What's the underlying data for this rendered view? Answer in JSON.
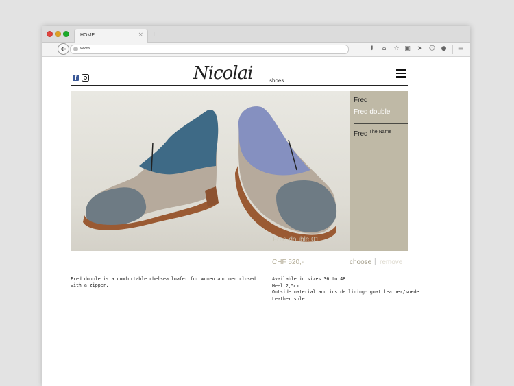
{
  "browser": {
    "tab_title": "HOME",
    "tab_close": "×",
    "new_tab": "+",
    "url": "www"
  },
  "header": {
    "logo_text": "Nicolai",
    "logo_sub": "shoes"
  },
  "product_menu": {
    "item1": "Fred",
    "item2": "Fred double",
    "item3": "Fred",
    "item3_sup": "The Name"
  },
  "photo": {
    "caption": "Fred double 01"
  },
  "actions": {
    "price": "CHF 520,-",
    "choose": "choose",
    "separator": "|",
    "remove": "remove"
  },
  "description": "Fred double is a comfortable chelsea loafer for women and men closed with a zipper.",
  "specs": [
    "Available in sizes 36 to 48",
    "Heel 2,5cm",
    "Outside material and inside lining: goat leather/suede",
    "Leather sole"
  ],
  "colors": {
    "sidebar_bg": "#bfb9a6",
    "accent_text": "#a09a86"
  }
}
